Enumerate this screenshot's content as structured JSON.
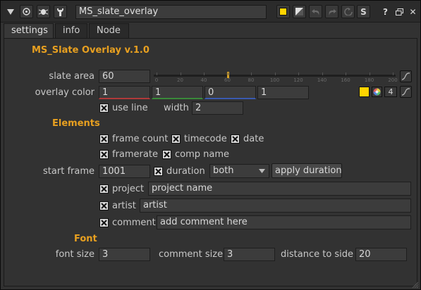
{
  "titlebar": {
    "node_name": "MS_slate_overlay",
    "collapse_icon": "triangle-down-icon",
    "center_icon": "target-icon",
    "bug_icon": "bug-icon",
    "wrench_icon": "wrench-icon",
    "color_icon": "yellow-swatch-icon",
    "alpha_icon": "checker-icon",
    "undo_icon": "undo-icon",
    "redo_icon": "redo-icon",
    "revert_icon": "revert-icon",
    "s_label": "S",
    "help_label": "?",
    "float_icon": "float-icon",
    "close_label": "✕"
  },
  "tabs": [
    {
      "label": "settings",
      "active": true
    },
    {
      "label": "info",
      "active": false
    },
    {
      "label": "Node",
      "active": false
    }
  ],
  "header_title": "MS_Slate Overlay v.1.0",
  "slate_area": {
    "label": "slate area",
    "value": "60",
    "slider_value": 60,
    "slider_range": [
      0,
      200
    ],
    "ticks": [
      "0",
      "20",
      "40",
      "60",
      "80",
      "100",
      "120",
      "140",
      "160",
      "180",
      "200"
    ]
  },
  "overlay_color": {
    "label": "overlay color",
    "r": "1",
    "g": "1",
    "b": "0",
    "a": "1",
    "channels_label": "4"
  },
  "use_line": {
    "label": "use line",
    "checked": true
  },
  "width": {
    "label": "width",
    "value": "2"
  },
  "elements": {
    "title": "Elements",
    "frame_count": "frame count",
    "timecode": "timecode",
    "date": "date",
    "framerate": "framerate",
    "comp_name": "comp name"
  },
  "start_frame": {
    "label": "start frame",
    "value": "1001"
  },
  "duration": {
    "label": "duration",
    "option": "both"
  },
  "apply_duration": "apply duration",
  "project": {
    "label": "project",
    "value": "project name"
  },
  "artist": {
    "label": "artist",
    "value": "artist"
  },
  "comment": {
    "label": "comment",
    "value": "add comment here"
  },
  "font": {
    "title": "Font",
    "font_size_label": "font size",
    "font_size": "3",
    "comment_size_label": "comment size",
    "comment_size": "3",
    "distance_label": "distance to side",
    "distance": "20"
  },
  "colors": {
    "accent": "#e8a020",
    "swatch": "#ffd400"
  }
}
